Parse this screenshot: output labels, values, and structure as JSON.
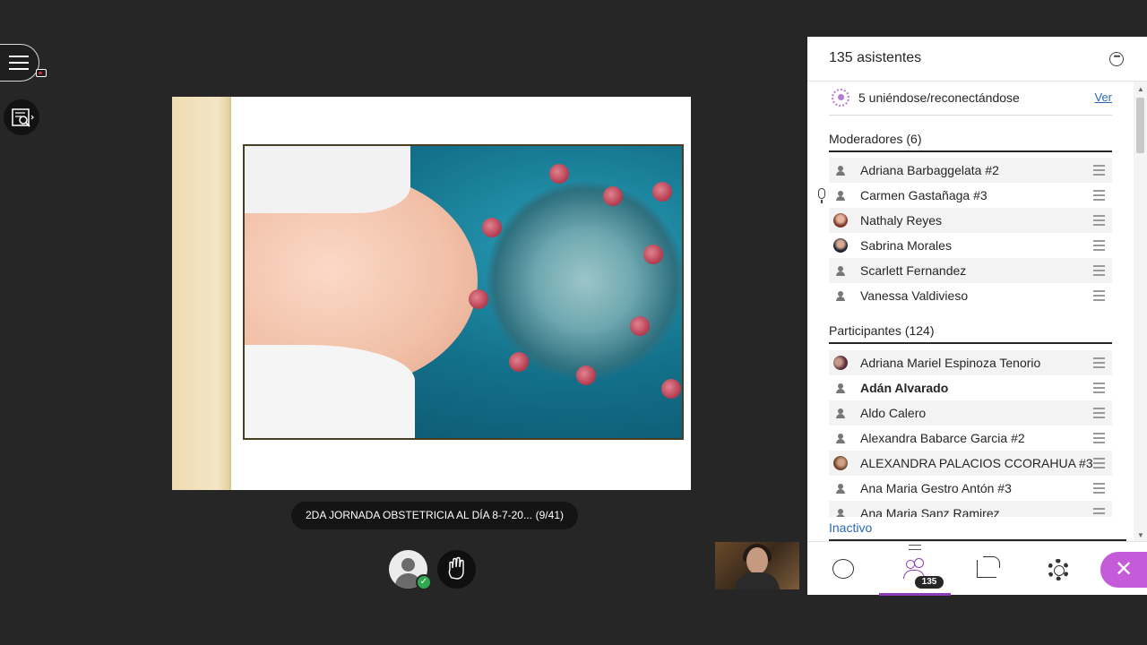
{
  "slide": {
    "caption": "2DA JORNADA OBSTETRICIA AL DÍA 8-7-20...",
    "page_counter": "(9/41)"
  },
  "panel": {
    "title": "135 asistentes",
    "joining": {
      "text": "5 uniéndose/reconectándose",
      "link": "Ver"
    },
    "moderators": {
      "heading": "Moderadores (6)",
      "items": [
        {
          "name": "Adriana Barbaggelata #2"
        },
        {
          "name": "Carmen Gastañaga #3"
        },
        {
          "name": "Nathaly Reyes"
        },
        {
          "name": "Sabrina Morales"
        },
        {
          "name": "Scarlett Fernandez"
        },
        {
          "name": "Vanessa Valdivieso"
        }
      ]
    },
    "participants": {
      "heading": "Participantes (124)",
      "items": [
        {
          "name": "Adriana Mariel Espinoza Tenorio"
        },
        {
          "name": "Adán Alvarado"
        },
        {
          "name": "Aldo Calero"
        },
        {
          "name": "Alexandra Babarce Garcia #2"
        },
        {
          "name": "ALEXANDRA PALACIOS CCORAHUA #3"
        },
        {
          "name": "Ana Maria Gestro Antón #3"
        },
        {
          "name": "Ana Maria Sanz Ramirez"
        }
      ]
    },
    "inactive_label": "Inactivo"
  },
  "toolbar": {
    "attendee_badge": "135",
    "close_glyph": "✕"
  },
  "icons": {
    "menu": "hamburger-menu-icon",
    "search": "search-document-icon",
    "more": "more-options-icon",
    "chat": "chat-icon",
    "people": "attendees-icon",
    "share": "share-content-icon",
    "settings": "gear-icon",
    "close": "close-icon"
  },
  "colors": {
    "accent": "#8d3bb6",
    "close_button": "#c55bd8",
    "link": "#2a68b0",
    "status_ok": "#2fa84f"
  }
}
